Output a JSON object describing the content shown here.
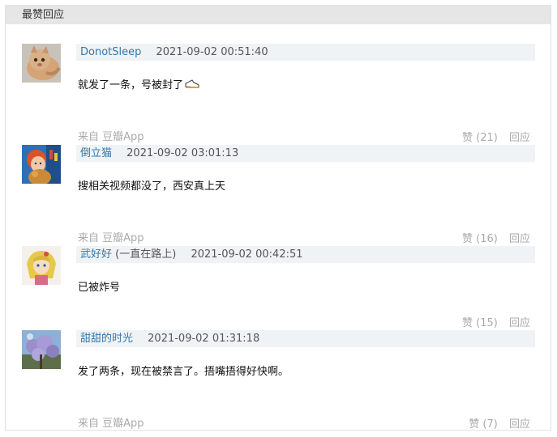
{
  "panel": {
    "title": "最赞回应"
  },
  "comments": [
    {
      "author": "DonotSleep",
      "author_extra": "",
      "time": "2021-09-02 00:51:40",
      "text": "就发了一条，号被封了",
      "icon": "sneaker-emoji-icon",
      "source": "来自 豆瓣App",
      "likes": "赞 (21)",
      "reply": "回应"
    },
    {
      "author": "倒立猫",
      "author_extra": "",
      "time": "2021-09-02 03:01:13",
      "text": "搜相关视频都没了，西安真上天",
      "source": "来自 豆瓣App",
      "likes": "赞 (16)",
      "reply": "回应"
    },
    {
      "author": "武好好",
      "author_extra": "(一直在路上)",
      "time": "2021-09-02 00:42:51",
      "text": "已被炸号",
      "source": "",
      "likes": "赞 (15)",
      "reply": "回应"
    },
    {
      "author": "甜甜的时光",
      "author_extra": "",
      "time": "2021-09-02 01:31:18",
      "text": "发了两条，现在被禁言了。捂嘴捂得好快啊。",
      "source": "来自 豆瓣App",
      "likes": "赞 (7)",
      "reply": "回应"
    }
  ]
}
